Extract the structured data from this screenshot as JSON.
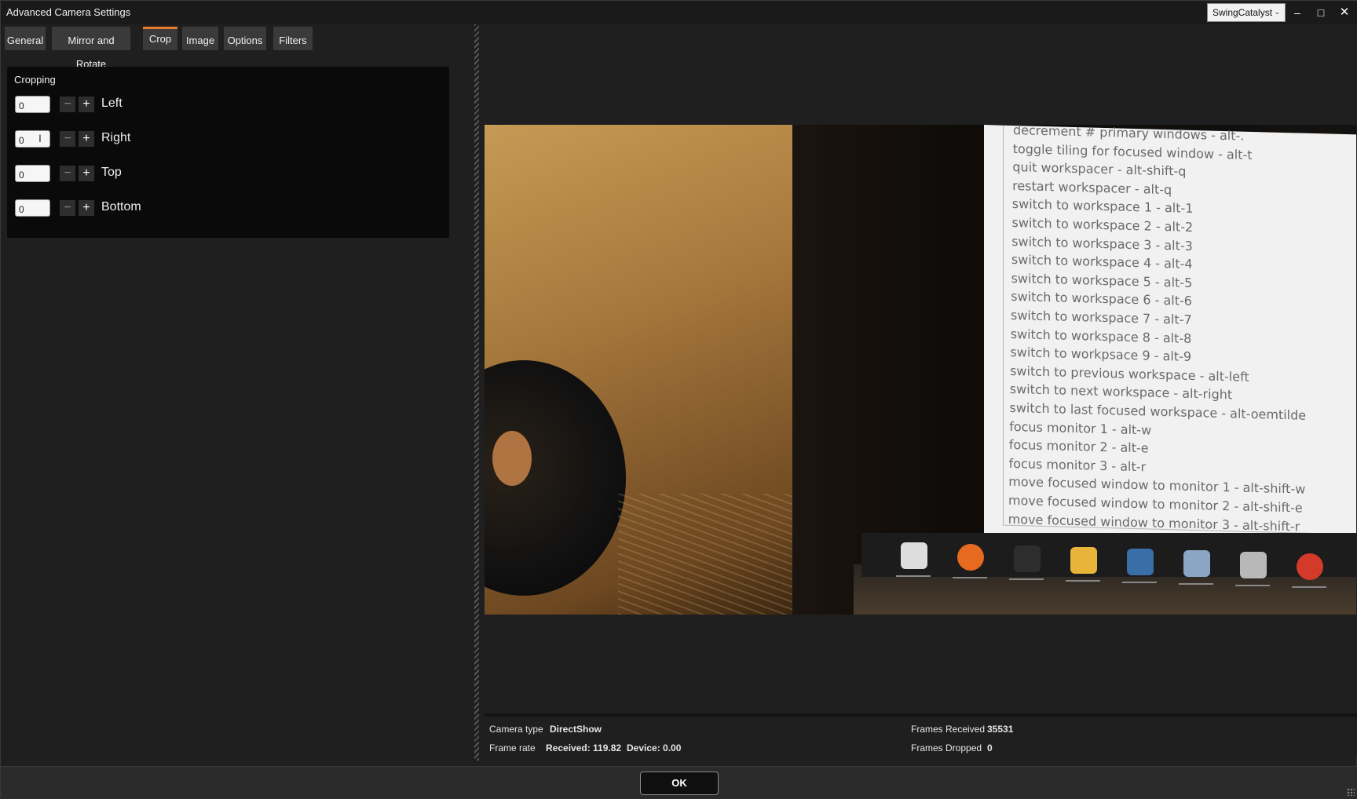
{
  "window": {
    "title": "Advanced Camera Settings",
    "profile": "SwingCatalyst",
    "minimize_icon": "minimize-icon",
    "maximize_icon": "maximize-icon",
    "close_icon": "close-icon",
    "minimize_glyph": "–",
    "maximize_glyph": "□",
    "close_glyph": "✕"
  },
  "tabs": [
    {
      "label": "General",
      "active": false
    },
    {
      "label": "Mirror and Rotate",
      "active": false
    },
    {
      "label": "Crop",
      "active": true
    },
    {
      "label": "Image",
      "active": false
    },
    {
      "label": "Options",
      "active": false
    },
    {
      "label": "Filters",
      "active": false
    }
  ],
  "cropping": {
    "title": "Cropping",
    "minus_glyph": "−",
    "plus_glyph": "+",
    "rows": [
      {
        "label": "Left",
        "value": "0"
      },
      {
        "label": "Right",
        "value": "0"
      },
      {
        "label": "Top",
        "value": "0"
      },
      {
        "label": "Bottom",
        "value": "0"
      }
    ]
  },
  "preview": {
    "screen_lines": [
      "decrement # primary windows  -  alt-.",
      "toggle tiling for focused window  -  alt-t",
      "quit workspacer  -  alt-shift-q",
      "restart workspacer  -  alt-q",
      "switch to workspace 1  -  alt-1",
      "switch to workspace 2  -  alt-2",
      "switch to workspace 3  -  alt-3",
      "switch to workspace 4  -  alt-4",
      "switch to workspace 5  -  alt-5",
      "switch to workspace 6  -  alt-6",
      "switch to workspace 7  -  alt-7",
      "switch to workspace 8  -  alt-8",
      "switch to workpsace 9  -  alt-9",
      "switch to previous workspace  -  alt-left",
      "switch to next workspace  -  alt-right",
      "switch to last focused workspace  -  alt-oemtilde",
      "focus monitor 1  -  alt-w",
      "focus monitor 2  -  alt-e",
      "focus monitor 3  -  alt-r",
      "move focused window to monitor 1  -  alt-shift-w",
      "move focused window to monitor 2  -  alt-shift-e",
      "move focused window to monitor 3  -  alt-shift-r"
    ],
    "taskbar_icons": [
      {
        "name": "windows-start-icon",
        "color": "#dddddd"
      },
      {
        "name": "firefox-icon",
        "color": "#e66a1f"
      },
      {
        "name": "terminal-icon",
        "color": "#2d2d2d"
      },
      {
        "name": "folder-icon",
        "color": "#e8b43a"
      },
      {
        "name": "accessibility-icon",
        "color": "#3a6ea8"
      },
      {
        "name": "image-viewer-icon",
        "color": "#8aa6c4"
      },
      {
        "name": "scanner-icon",
        "color": "#b8b8b8"
      },
      {
        "name": "ccleaner-icon",
        "color": "#d43a2a"
      }
    ]
  },
  "status": {
    "camera_type_label": "Camera type",
    "camera_type_value": "DirectShow",
    "frame_rate_label": "Frame rate",
    "received_value": "Received: 119.82",
    "device_value": "Device: 0.00",
    "frames_received_label": "Frames Received",
    "frames_received_value": "35531",
    "frames_dropped_label": "Frames Dropped",
    "frames_dropped_value": "0"
  },
  "footer": {
    "ok_label": "OK"
  }
}
